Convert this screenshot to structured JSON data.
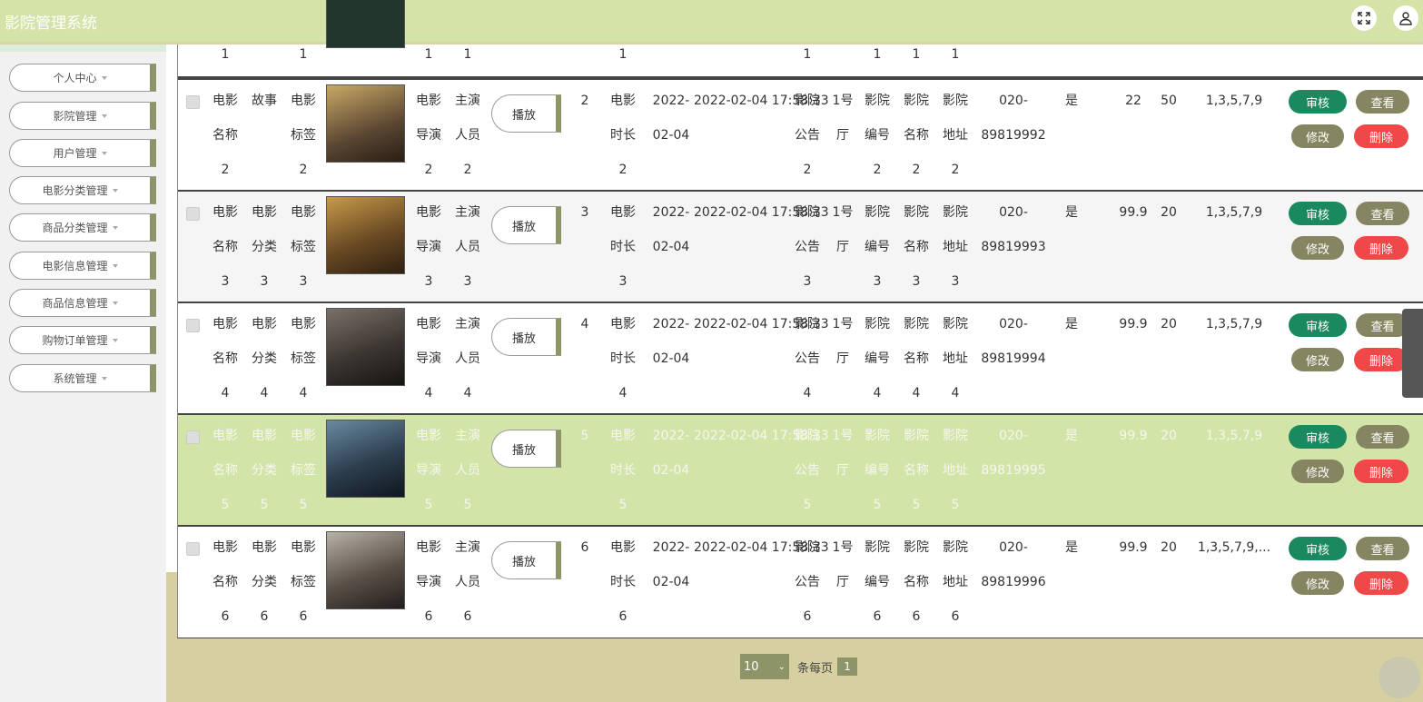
{
  "app": {
    "title": "影院管理系统"
  },
  "sidebar": {
    "items": [
      {
        "label": "个人中心"
      },
      {
        "label": "影院管理"
      },
      {
        "label": "用户管理"
      },
      {
        "label": "电影分类管理"
      },
      {
        "label": "商品分类管理"
      },
      {
        "label": "电影信息管理"
      },
      {
        "label": "商品信息管理"
      },
      {
        "label": "购物订单管理"
      },
      {
        "label": "系统管理"
      }
    ]
  },
  "partial_row": [
    "1",
    "1",
    "1",
    "1",
    "1",
    "1",
    "1",
    "1",
    "1"
  ],
  "rows": [
    {
      "name": [
        "电影",
        "名称",
        "2"
      ],
      "cat": [
        "故事",
        "",
        ""
      ],
      "tag": [
        "电影",
        "标签",
        "2"
      ],
      "director": [
        "电影",
        "导演",
        "2"
      ],
      "actor": [
        "主演",
        "人员",
        "2"
      ],
      "play": "播放",
      "id": "2",
      "dur": [
        "电影",
        "时长",
        "2"
      ],
      "date": [
        "2022-",
        "02-04"
      ],
      "datetime": "2022-02-04 17:58:33",
      "notice": [
        "影院",
        "公告",
        "2"
      ],
      "hall": [
        "1号",
        "厅"
      ],
      "code": [
        "影院",
        "编号",
        "2"
      ],
      "cname": [
        "影院",
        "名称",
        "2"
      ],
      "addr": [
        "影院",
        "地址",
        "2"
      ],
      "phone": [
        "020-",
        "89819992"
      ],
      "flag": "是",
      "price": "22",
      "seats": "50",
      "seq": "1,3,5,7,9",
      "audit": "审核",
      "view": "查看",
      "edit": "修改",
      "del": "删除"
    },
    {
      "name": [
        "电影",
        "名称",
        "3"
      ],
      "cat": [
        "电影",
        "分类",
        "3"
      ],
      "tag": [
        "电影",
        "标签",
        "3"
      ],
      "director": [
        "电影",
        "导演",
        "3"
      ],
      "actor": [
        "主演",
        "人员",
        "3"
      ],
      "play": "播放",
      "id": "3",
      "dur": [
        "电影",
        "时长",
        "3"
      ],
      "date": [
        "2022-",
        "02-04"
      ],
      "datetime": "2022-02-04 17:58:33",
      "notice": [
        "影院",
        "公告",
        "3"
      ],
      "hall": [
        "1号",
        "厅"
      ],
      "code": [
        "影院",
        "编号",
        "3"
      ],
      "cname": [
        "影院",
        "名称",
        "3"
      ],
      "addr": [
        "影院",
        "地址",
        "3"
      ],
      "phone": [
        "020-",
        "89819993"
      ],
      "flag": "是",
      "price": "99.9",
      "seats": "20",
      "seq": "1,3,5,7,9",
      "audit": "审核",
      "view": "查看",
      "edit": "修改",
      "del": "删除"
    },
    {
      "name": [
        "电影",
        "名称",
        "4"
      ],
      "cat": [
        "电影",
        "分类",
        "4"
      ],
      "tag": [
        "电影",
        "标签",
        "4"
      ],
      "director": [
        "电影",
        "导演",
        "4"
      ],
      "actor": [
        "主演",
        "人员",
        "4"
      ],
      "play": "播放",
      "id": "4",
      "dur": [
        "电影",
        "时长",
        "4"
      ],
      "date": [
        "2022-",
        "02-04"
      ],
      "datetime": "2022-02-04 17:58:33",
      "notice": [
        "影院",
        "公告",
        "4"
      ],
      "hall": [
        "1号",
        "厅"
      ],
      "code": [
        "影院",
        "编号",
        "4"
      ],
      "cname": [
        "影院",
        "名称",
        "4"
      ],
      "addr": [
        "影院",
        "地址",
        "4"
      ],
      "phone": [
        "020-",
        "89819994"
      ],
      "flag": "是",
      "price": "99.9",
      "seats": "20",
      "seq": "1,3,5,7,9",
      "audit": "审核",
      "view": "查看",
      "edit": "修改",
      "del": "删除"
    },
    {
      "name": [
        "电影",
        "名称",
        "5"
      ],
      "cat": [
        "电影",
        "分类",
        "5"
      ],
      "tag": [
        "电影",
        "标签",
        "5"
      ],
      "director": [
        "电影",
        "导演",
        "5"
      ],
      "actor": [
        "主演",
        "人员",
        "5"
      ],
      "play": "播放",
      "id": "5",
      "dur": [
        "电影",
        "时长",
        "5"
      ],
      "date": [
        "2022-",
        "02-04"
      ],
      "datetime": "2022-02-04 17:58:33",
      "notice": [
        "影院",
        "公告",
        "5"
      ],
      "hall": [
        "1号",
        "厅"
      ],
      "code": [
        "影院",
        "编号",
        "5"
      ],
      "cname": [
        "影院",
        "名称",
        "5"
      ],
      "addr": [
        "影院",
        "地址",
        "5"
      ],
      "phone": [
        "020-",
        "89819995"
      ],
      "flag": "是",
      "price": "99.9",
      "seats": "20",
      "seq": "1,3,5,7,9",
      "audit": "审核",
      "view": "查看",
      "edit": "修改",
      "del": "删除"
    },
    {
      "name": [
        "电影",
        "名称",
        "6"
      ],
      "cat": [
        "电影",
        "分类",
        "6"
      ],
      "tag": [
        "电影",
        "标签",
        "6"
      ],
      "director": [
        "电影",
        "导演",
        "6"
      ],
      "actor": [
        "主演",
        "人员",
        "6"
      ],
      "play": "播放",
      "id": "6",
      "dur": [
        "电影",
        "时长",
        "6"
      ],
      "date": [
        "2022-",
        "02-04"
      ],
      "datetime": "2022-02-04 17:58:33",
      "notice": [
        "影院",
        "公告",
        "6"
      ],
      "hall": [
        "1号",
        "厅"
      ],
      "code": [
        "影院",
        "编号",
        "6"
      ],
      "cname": [
        "影院",
        "名称",
        "6"
      ],
      "addr": [
        "影院",
        "地址",
        "6"
      ],
      "phone": [
        "020-",
        "89819996"
      ],
      "flag": "是",
      "price": "99.9",
      "seats": "20",
      "seq": "1,3,5,7,9,...",
      "audit": "审核",
      "view": "查看",
      "edit": "修改",
      "del": "删除"
    }
  ],
  "pager": {
    "page_size": "10",
    "per_page_label": "条每页",
    "current_page": "1"
  },
  "colors": {
    "header": "#d4e4a9",
    "accent": "#8c9468",
    "audit": "#1a8a5e",
    "delete": "#f04848",
    "selected_row": "#d3e4a8"
  },
  "icons": {
    "fullscreen": "fullscreen-icon",
    "user": "user-icon"
  }
}
